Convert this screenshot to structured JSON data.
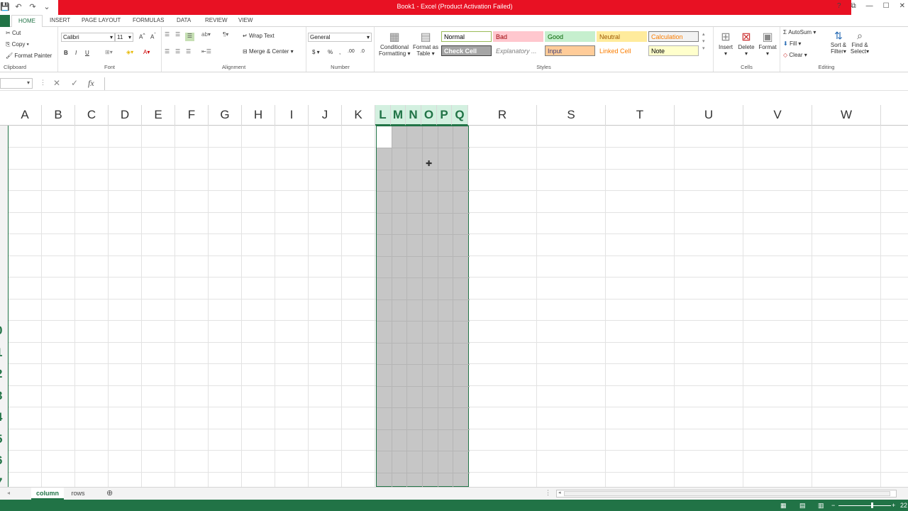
{
  "window": {
    "title": "Book1 - Excel (Product Activation Failed)",
    "help": "?",
    "controls": [
      "⧉",
      "—",
      "☐",
      "✕"
    ]
  },
  "qat": [
    "💾",
    "↶",
    "↷",
    "⌄"
  ],
  "tabs": [
    "HOME",
    "INSERT",
    "PAGE LAYOUT",
    "FORMULAS",
    "DATA",
    "REVIEW",
    "VIEW"
  ],
  "clipboard": {
    "cut": "Cut",
    "copy": "Copy",
    "painter": "Format Painter",
    "label": "Clipboard"
  },
  "font": {
    "name": "Calibri",
    "size": "11",
    "bold": "B",
    "italic": "I",
    "underline": "U",
    "label": "Font"
  },
  "alignment": {
    "wrap": "Wrap Text",
    "merge": "Merge & Center",
    "label": "Alignment"
  },
  "number": {
    "format": "General",
    "label": "Number"
  },
  "styles": {
    "conditional": [
      "Conditional",
      "Formatting"
    ],
    "format_table": [
      "Format as",
      "Table"
    ],
    "label": "Styles",
    "cells": [
      {
        "text": "Normal",
        "bg": "#ffffff",
        "fg": "#000000",
        "border": "#9bbb59"
      },
      {
        "text": "Bad",
        "bg": "#ffc7ce",
        "fg": "#9c0006",
        "border": "#ffc7ce"
      },
      {
        "text": "Good",
        "bg": "#c6efce",
        "fg": "#006100",
        "border": "#c6efce"
      },
      {
        "text": "Neutral",
        "bg": "#ffeb9c",
        "fg": "#9c5700",
        "border": "#ffeb9c"
      },
      {
        "text": "Calculation",
        "bg": "#f2f2f2",
        "fg": "#fa7d00",
        "border": "#7f7f7f"
      },
      {
        "text": "Check Cell",
        "bg": "#a5a5a5",
        "fg": "#ffffff",
        "border": "#3f3f3f"
      },
      {
        "text": "Explanatory ...",
        "bg": "#ffffff",
        "fg": "#7f7f7f",
        "border": "#ffffff"
      },
      {
        "text": "Input",
        "bg": "#ffcc99",
        "fg": "#3f3f76",
        "border": "#7f7f7f"
      },
      {
        "text": "Linked Cell",
        "bg": "#ffffff",
        "fg": "#fa7d00",
        "border": "#ffffff"
      },
      {
        "text": "Note",
        "bg": "#ffffcc",
        "fg": "#000000",
        "border": "#b2b2b2"
      }
    ]
  },
  "cells_group": {
    "insert": "Insert",
    "delete": "Delete",
    "format": "Format",
    "label": "Cells"
  },
  "editing": {
    "autosum": "AutoSum",
    "fill": "Fill",
    "clear": "Clear",
    "sort": [
      "Sort &",
      "Filter"
    ],
    "find": [
      "Find &",
      "Select"
    ],
    "label": "Editing"
  },
  "formula_bar": {
    "fx": "fx",
    "cancel": "✕",
    "enter": "✓",
    "value": ""
  },
  "columns": [
    "A",
    "B",
    "C",
    "D",
    "E",
    "F",
    "G",
    "H",
    "I",
    "J",
    "K",
    "L",
    "M",
    "N",
    "O",
    "P",
    "Q",
    "R",
    "S",
    "T",
    "U",
    "V",
    "W"
  ],
  "selected_columns": [
    "L",
    "M",
    "N",
    "O",
    "P",
    "Q"
  ],
  "row_numbers_partial": [
    "0",
    "1",
    "2",
    "3",
    "4",
    "5",
    "6",
    "7"
  ],
  "sheets": [
    {
      "name": "column",
      "active": true
    },
    {
      "name": "rows",
      "active": false
    }
  ],
  "status": {
    "zoom": "22"
  },
  "colors": {
    "accent": "#217346",
    "title_bar": "#e81123",
    "selection": "#c6c6c6"
  }
}
